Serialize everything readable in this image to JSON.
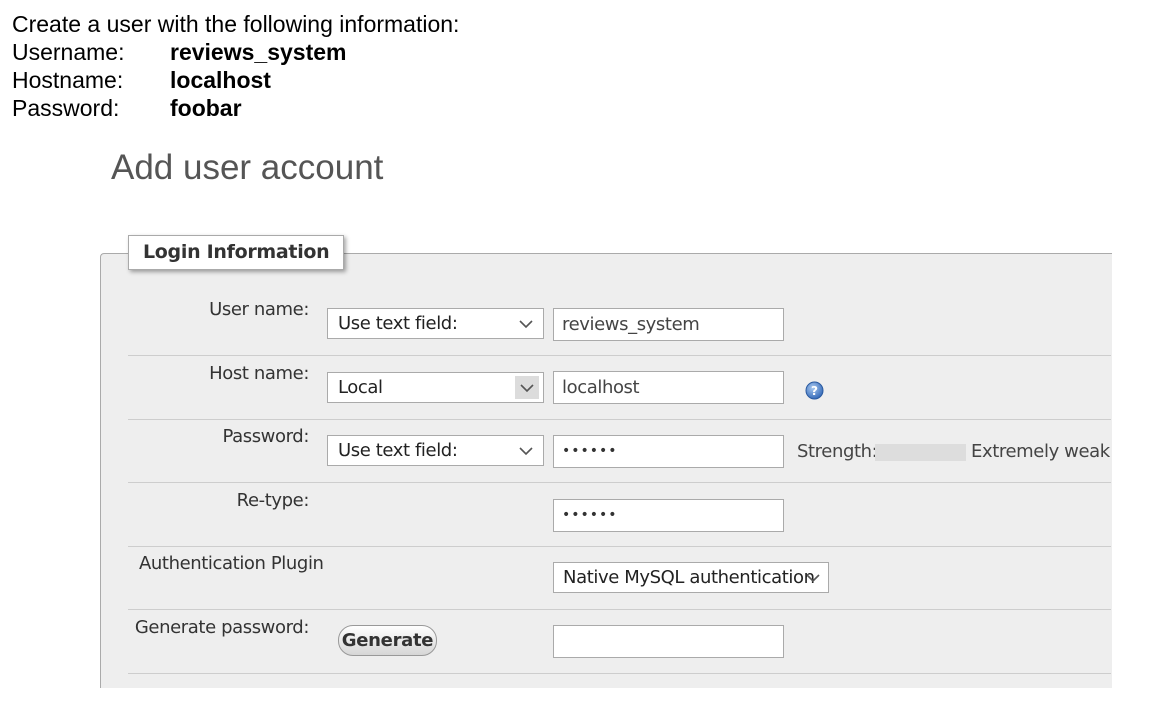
{
  "instructions": {
    "heading": "Create a user with the following information:",
    "rows": [
      {
        "key": "Username:",
        "value": "reviews_system"
      },
      {
        "key": "Hostname:",
        "value": "localhost"
      },
      {
        "key": "Password:",
        "value": "foobar"
      }
    ]
  },
  "page_title": "Add user account",
  "legend": "Login Information",
  "form": {
    "user_name": {
      "label": "User name:",
      "select": "Use text field:",
      "value": "reviews_system"
    },
    "host_name": {
      "label": "Host name:",
      "select": "Local",
      "value": "localhost",
      "help_icon": "help-icon"
    },
    "password": {
      "label": "Password:",
      "select": "Use text field:",
      "value": "••••••",
      "strength_label": "Strength:",
      "strength_text": "Extremely weak"
    },
    "retype": {
      "label": "Re-type:",
      "value": "••••••"
    },
    "auth_plugin": {
      "label": "Authentication Plugin",
      "select": "Native MySQL authentication"
    },
    "generate": {
      "label": "Generate password:",
      "button": "Generate",
      "value": ""
    }
  },
  "colors": {
    "panel_bg": "#eeeeee",
    "help_icon": "#3b78c8",
    "meter_bg": "#dddddd"
  }
}
